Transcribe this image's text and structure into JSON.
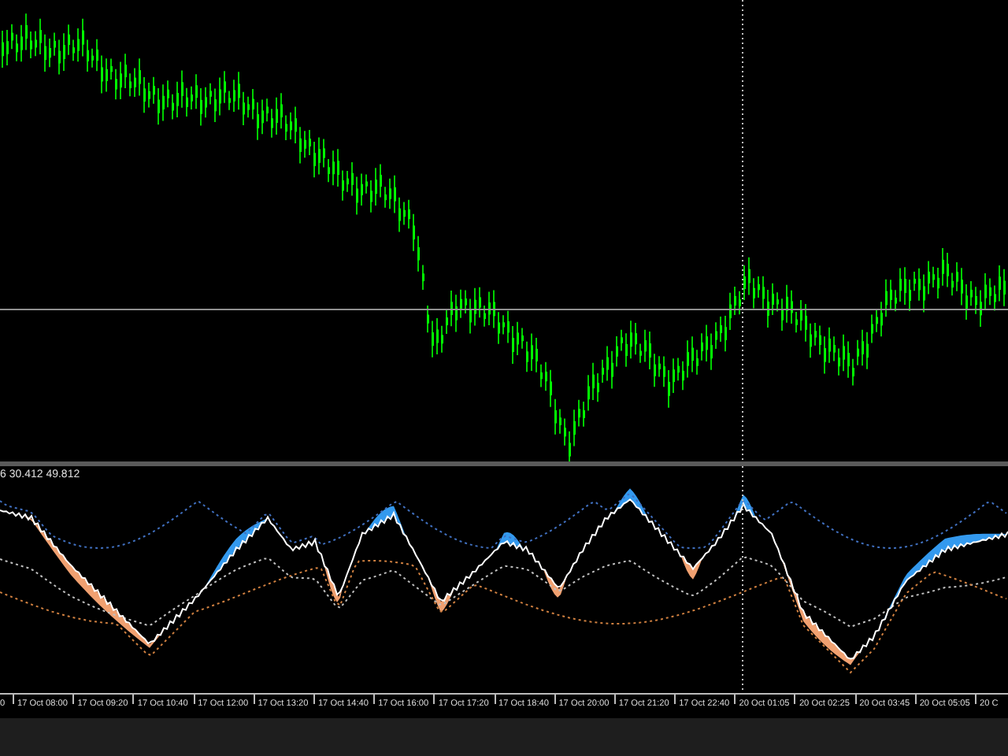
{
  "indicator": {
    "values_label": "6 30.412 49.812"
  },
  "time_axis": {
    "labels": [
      "0",
      "17 Oct 08:00",
      "17 Oct 09:20",
      "17 Oct 10:40",
      "17 Oct 12:00",
      "17 Oct 13:20",
      "17 Oct 14:40",
      "17 Oct 16:00",
      "17 Oct 17:20",
      "17 Oct 18:40",
      "17 Oct 20:00",
      "17 Oct 21:20",
      "17 Oct 22:40",
      "20 Oct 01:05",
      "20 Oct 02:25",
      "20 Oct 03:45",
      "20 Oct 05:05",
      "20 C"
    ]
  }
}
